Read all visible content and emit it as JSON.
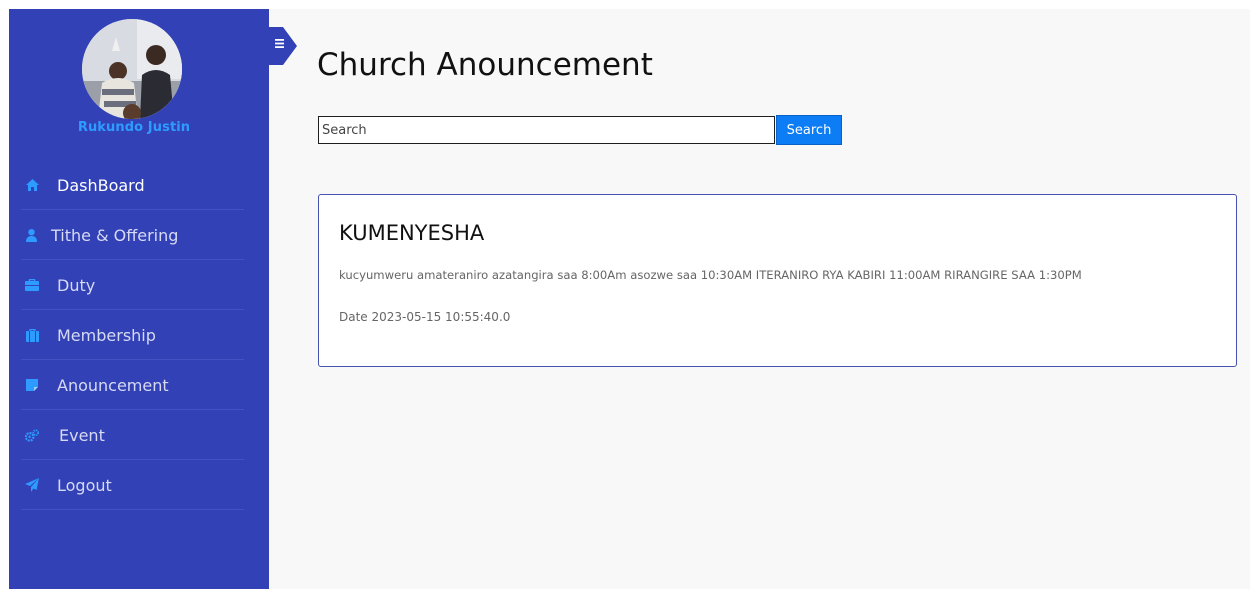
{
  "colors": {
    "sidebar": "#3241b6",
    "accent": "#2d9bff",
    "button": "#0d7df6",
    "card_border": "#4653b0"
  },
  "sidebar": {
    "user_name": "Rukundo Justin",
    "items": [
      {
        "label": "DashBoard",
        "icon": "home-icon",
        "active": true
      },
      {
        "label": "Tithe & Offering",
        "icon": "user-icon",
        "active": false
      },
      {
        "label": "Duty",
        "icon": "briefcase-icon",
        "active": false
      },
      {
        "label": "Membership",
        "icon": "suitcase-icon",
        "active": false
      },
      {
        "label": "Anouncement",
        "icon": "note-icon",
        "active": false
      },
      {
        "label": "Event",
        "icon": "gears-icon",
        "active": false
      },
      {
        "label": "Logout",
        "icon": "paper-plane-icon",
        "active": false
      }
    ]
  },
  "header": {
    "toggle_icon": "hamburger-menu-icon",
    "title": "Church Anouncement"
  },
  "search": {
    "placeholder": "Search",
    "value": "",
    "button_label": "Search"
  },
  "announcements": [
    {
      "title": "KUMENYESHA",
      "body": "kucyumweru amateraniro azatangira saa 8:00Am asozwe saa 10:30AM ITERANIRO RYA KABIRI 11:00AM RIRANGIRE SAA 1:30PM",
      "date": "Date 2023-05-15 10:55:40.0"
    }
  ]
}
